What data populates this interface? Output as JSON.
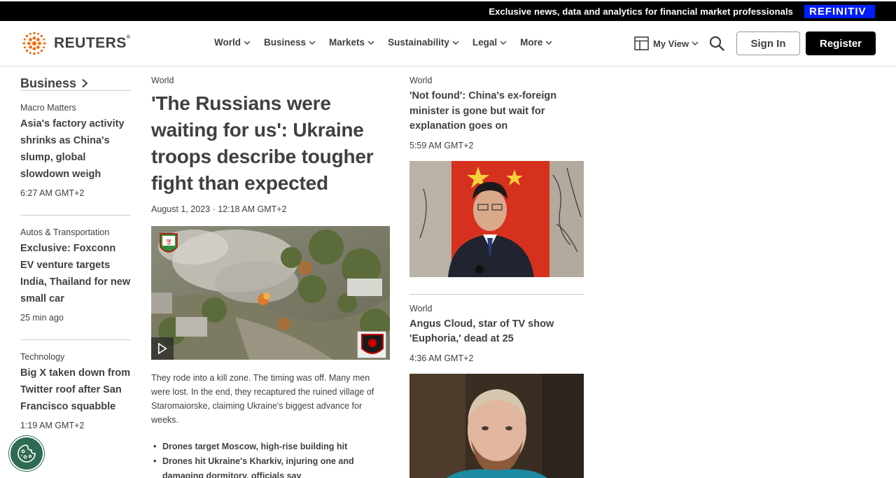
{
  "topbar": {
    "promo_text": "Exclusive news, data and analytics for financial market professionals",
    "brand": "REFINITIV"
  },
  "header": {
    "logo_text": "REUTERS",
    "logo_reg": "®",
    "nav": [
      {
        "label": "World"
      },
      {
        "label": "Business"
      },
      {
        "label": "Markets"
      },
      {
        "label": "Sustainability"
      },
      {
        "label": "Legal"
      },
      {
        "label": "More"
      }
    ],
    "my_view_label": "My View",
    "sign_in_label": "Sign In",
    "register_label": "Register"
  },
  "sidebar": {
    "section_title": "Business",
    "stories": [
      {
        "kicker": "Macro Matters",
        "headline": "Asia's factory activity shrinks as China's slump, global slowdown weigh",
        "time": "6:27 AM GMT+2"
      },
      {
        "kicker": "Autos & Transportation",
        "headline": "Exclusive: Foxconn EV venture targets India, Thailand for new small car",
        "time": "25 min ago"
      },
      {
        "kicker": "Technology",
        "headline": "Big X taken down from Twitter roof after San Francisco squabble",
        "time": "1:19 AM GMT+2"
      }
    ]
  },
  "main": {
    "kicker": "World",
    "headline": "'The Russians were waiting for us': Ukraine troops describe tougher fight than expected",
    "timestamp": "August 1, 2023 · 12:18 AM GMT+2",
    "summary": "They rode into a kill zone. The timing was off. Many men were lost. In the end, they recaptured the ruined village of Staromaiorske, claiming Ukraine's biggest advance for weeks.",
    "bullets": [
      "Drones target Moscow, high-rise building hit",
      "Drones hit Ukraine's Kharkiv, injuring one and damaging dormitory, officials say"
    ]
  },
  "right": {
    "stories": [
      {
        "kicker": "World",
        "headline": "'Not found': China's ex-foreign minister is gone but wait for explanation goes on",
        "time": "5:59 AM GMT+2"
      },
      {
        "kicker": "World",
        "headline": "Angus Cloud, star of TV show 'Euphoria,' dead at 25",
        "time": "4:36 AM GMT+2"
      }
    ]
  },
  "colors": {
    "refinitiv_blue": "#001eff",
    "reuters_orange": "#fa6400",
    "cookie_green": "#2e6b52"
  }
}
